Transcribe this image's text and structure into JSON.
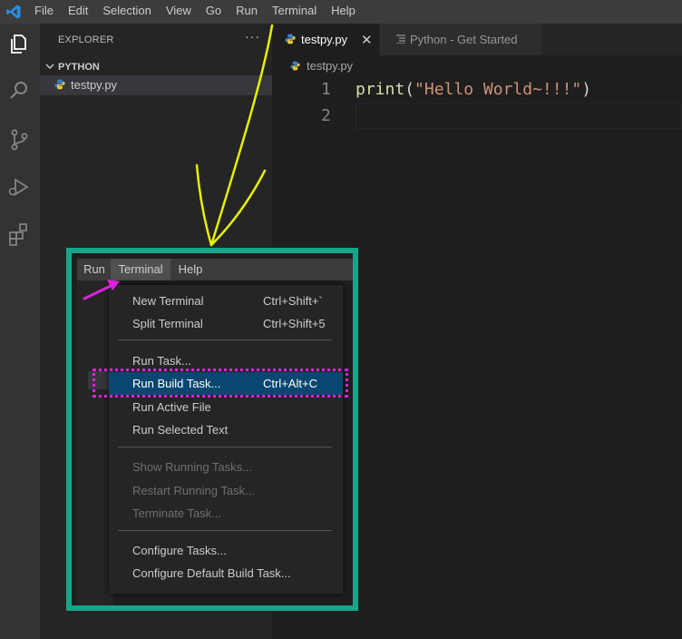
{
  "menubar": {
    "items": [
      "File",
      "Edit",
      "Selection",
      "View",
      "Go",
      "Run",
      "Terminal",
      "Help"
    ]
  },
  "activity_icons": [
    "explorer-icon",
    "search-icon",
    "source-control-icon",
    "run-debug-icon",
    "extensions-icon"
  ],
  "sidebar": {
    "header": "EXPLORER",
    "more": "···",
    "folder": "PYTHON",
    "file": "testpy.py"
  },
  "tabs": [
    {
      "label": "testpy.py",
      "active": true,
      "close": "✕"
    },
    {
      "label": "Python - Get Started",
      "active": false
    }
  ],
  "breadcrumb": "testpy.py",
  "editor": {
    "lines": [
      {
        "number": "1",
        "fn": "print",
        "open": "(",
        "str": "\"Hello World~!!!\"",
        "close": ")"
      },
      {
        "number": "2"
      }
    ]
  },
  "overlay": {
    "menubar": [
      "Run",
      "Terminal",
      "Help"
    ],
    "active_menu": "Terminal",
    "groups": [
      [
        {
          "label": "New Terminal",
          "shortcut": "Ctrl+Shift+`"
        },
        {
          "label": "Split Terminal",
          "shortcut": "Ctrl+Shift+5"
        }
      ],
      [
        {
          "label": "Run Task...",
          "shortcut": ""
        },
        {
          "label": "Run Build Task...",
          "shortcut": "Ctrl+Alt+C",
          "selected": true
        },
        {
          "label": "Run Active File",
          "shortcut": ""
        },
        {
          "label": "Run Selected Text",
          "shortcut": ""
        }
      ],
      [
        {
          "label": "Show Running Tasks...",
          "disabled": true
        },
        {
          "label": "Restart Running Task...",
          "disabled": true
        },
        {
          "label": "Terminate Task...",
          "disabled": true
        }
      ],
      [
        {
          "label": "Configure Tasks...",
          "shortcut": ""
        },
        {
          "label": "Configure Default Build Task...",
          "shortcut": ""
        }
      ]
    ]
  },
  "colors": {
    "frame": "#16a58a",
    "highlight_dotted": "#e020e0",
    "arrow_yellow": "#e6f000",
    "arrow_magenta": "#e020e0",
    "selected_item": "#094771",
    "fn": "#dcdcaa",
    "str": "#ce9178"
  }
}
